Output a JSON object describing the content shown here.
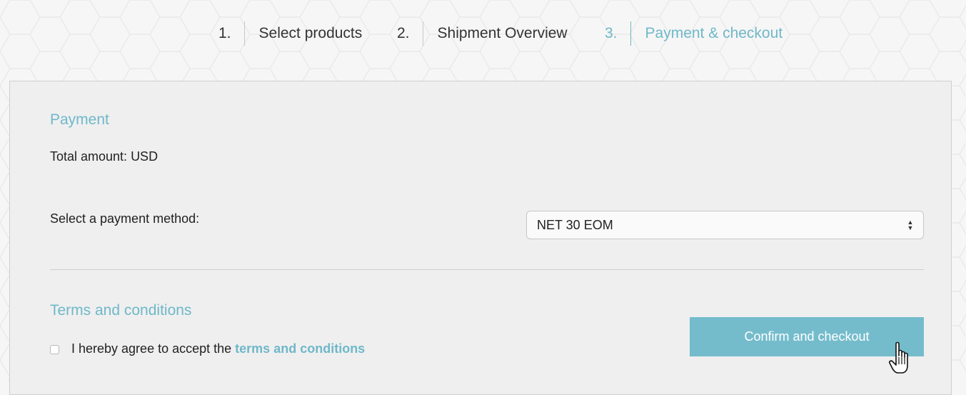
{
  "steps": [
    {
      "num": "1.",
      "label": "Select products",
      "active": false
    },
    {
      "num": "2.",
      "label": "Shipment Overview",
      "active": false
    },
    {
      "num": "3.",
      "label": "Payment & checkout",
      "active": true
    }
  ],
  "payment": {
    "title": "Payment",
    "total_text": "Total amount: USD",
    "method_label": "Select a payment method:",
    "method_selected": "NET 30 EOM"
  },
  "terms": {
    "title": "Terms and conditions",
    "agree_text": "I hereby agree to accept the",
    "link_text": "terms and conditions",
    "checked": false
  },
  "confirm_button": "Confirm and checkout",
  "colors": {
    "accent": "#6fb8c9",
    "button": "#74bccc",
    "panel_bg": "#efefef"
  },
  "icons": {
    "select_arrows": "up-down-arrows-icon",
    "cursor": "hand-pointer-icon"
  }
}
